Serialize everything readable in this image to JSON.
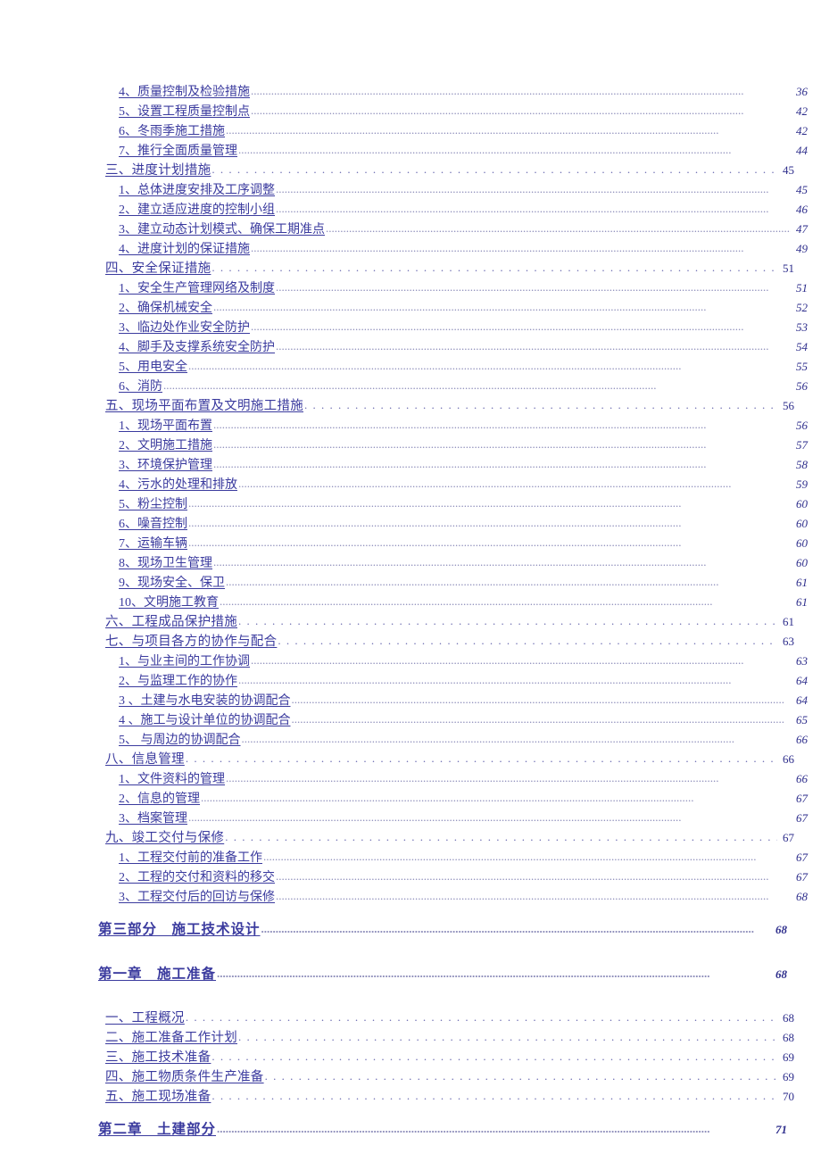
{
  "document": {
    "type": "table-of-contents",
    "language": "zh-CN",
    "text_color": "#3a3a9e",
    "leader_color": "#8a8ab8",
    "page_number_color": "#2e2e8c",
    "background": "#ffffff"
  },
  "entries": [
    {
      "level": "lvl2",
      "label": "4、质量控制及检验措施",
      "page": "36"
    },
    {
      "level": "lvl2",
      "label": "5、设置工程质量控制点",
      "page": "42"
    },
    {
      "level": "lvl2",
      "label": "6、冬雨季施工措施",
      "page": "42"
    },
    {
      "level": "lvl2",
      "label": "7、推行全面质量管理",
      "page": "44"
    },
    {
      "level": "lvl1",
      "label": "三、进度计划措施",
      "page": "45"
    },
    {
      "level": "lvl2",
      "label": "1、总体进度安排及工序调整",
      "page": "45"
    },
    {
      "level": "lvl2",
      "label": "2、建立适应进度的控制小组",
      "page": "46"
    },
    {
      "level": "lvl2",
      "label": "3、建立动态计划模式、确保工期准点",
      "page": "47"
    },
    {
      "level": "lvl2",
      "label": "4、进度计划的保证措施",
      "page": "49"
    },
    {
      "level": "lvl1",
      "label": "四、安全保证措施",
      "page": "51"
    },
    {
      "level": "lvl2",
      "label": "1、安全生产管理网络及制度",
      "page": "51"
    },
    {
      "level": "lvl2",
      "label": "2、确保机械安全",
      "page": "52"
    },
    {
      "level": "lvl2",
      "label": "3、临边处作业安全防护",
      "page": "53"
    },
    {
      "level": "lvl2",
      "label": "4、脚手及支撑系统安全防护",
      "page": "54"
    },
    {
      "level": "lvl2",
      "label": "5、用电安全",
      "page": "55"
    },
    {
      "level": "lvl2",
      "label": "6、消防",
      "page": "56"
    },
    {
      "level": "lvl1",
      "label": "五、现场平面布置及文明施工措施",
      "page": "56"
    },
    {
      "level": "lvl2",
      "label": "1、现场平面布置",
      "page": "56"
    },
    {
      "level": "lvl2",
      "label": "2、文明施工措施",
      "page": "57"
    },
    {
      "level": "lvl2",
      "label": "3、环境保护管理",
      "page": "58"
    },
    {
      "level": "lvl2",
      "label": "4、污水的处理和排放",
      "page": "59"
    },
    {
      "level": "lvl2",
      "label": "5、粉尘控制",
      "page": "60"
    },
    {
      "level": "lvl2",
      "label": "6、噪音控制",
      "page": "60"
    },
    {
      "level": "lvl2",
      "label": "7、运输车辆",
      "page": "60"
    },
    {
      "level": "lvl2",
      "label": "8、现场卫生管理",
      "page": "60"
    },
    {
      "level": "lvl2",
      "label": "9、现场安全、保卫",
      "page": "61"
    },
    {
      "level": "lvl2",
      "label": "10、文明施工教育",
      "page": "61"
    },
    {
      "level": "lvl1",
      "label": "六、工程成品保护措施",
      "page": "61"
    },
    {
      "level": "lvl1",
      "label": "七、与项目各方的协作与配合",
      "page": "63"
    },
    {
      "level": "lvl2",
      "label": "1、与业主间的工作协调",
      "page": "63"
    },
    {
      "level": "lvl2",
      "label": "2、与监理工作的协作",
      "page": "64"
    },
    {
      "level": "lvl2",
      "label": "3 、土建与水电安装的协调配合",
      "page": "64"
    },
    {
      "level": "lvl2",
      "label": "4 、施工与设计单位的协调配合",
      "page": "65"
    },
    {
      "level": "lvl2",
      "label": "5、 与周边的协调配合",
      "page": "66"
    },
    {
      "level": "lvl1",
      "label": "八、信息管理",
      "page": "66"
    },
    {
      "level": "lvl2",
      "label": "1、文件资料的管理",
      "page": "66"
    },
    {
      "level": "lvl2",
      "label": "2、信息的管理",
      "page": "67"
    },
    {
      "level": "lvl2",
      "label": "3、档案管理",
      "page": "67"
    },
    {
      "level": "lvl1",
      "label": "九、竣工交付与保修",
      "page": "67"
    },
    {
      "level": "lvl2",
      "label": "1、工程交付前的准备工作",
      "page": "67"
    },
    {
      "level": "lvl2",
      "label": "2、工程的交付和资料的移交",
      "page": "67"
    },
    {
      "level": "lvl2",
      "label": "3、工程交付后的回访与保修",
      "page": "68"
    },
    {
      "level": "part",
      "label": "第三部分　施工技术设计",
      "page": "68",
      "gap": true
    },
    {
      "level": "chapter",
      "label": "第一章　施工准备",
      "page": "68",
      "gap": true
    },
    {
      "level": "lvl1",
      "label": "一、工程概况",
      "page": "68",
      "gap": true
    },
    {
      "level": "lvl1",
      "label": "二、施工准备工作计划",
      "page": "68"
    },
    {
      "level": "lvl1",
      "label": "三、施工技术准备",
      "page": "69"
    },
    {
      "level": "lvl1",
      "label": "四、施工物质条件生产准备",
      "page": "69"
    },
    {
      "level": "lvl1",
      "label": "五、施工现场准备",
      "page": "70"
    },
    {
      "level": "chapter",
      "label": "第二章　土建部分",
      "page": "71",
      "gap": true
    }
  ]
}
